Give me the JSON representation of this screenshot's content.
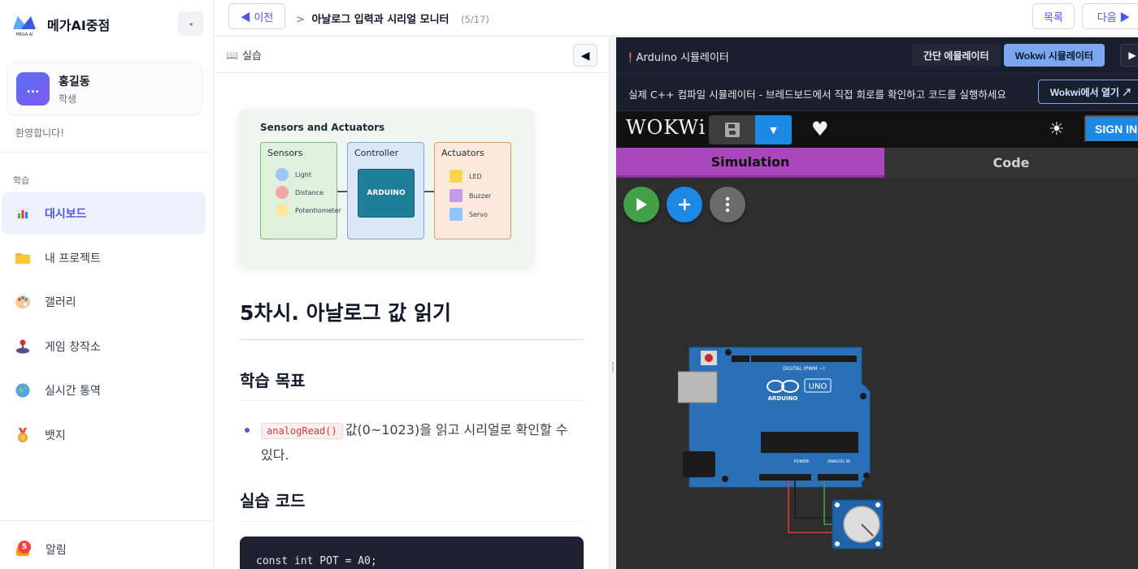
{
  "app": {
    "brand_logo_text": "MEGA AI",
    "brand_name": "메가AI중점",
    "collapse_glyph": "◂"
  },
  "user": {
    "avatar_text": "...",
    "name": "홍길동",
    "role": "학생",
    "welcome": "환영합니다!"
  },
  "sidebar": {
    "section_label": "학습",
    "items": [
      {
        "label": "대시보드",
        "icon": "chart-icon",
        "active": true
      },
      {
        "label": "내 프로젝트",
        "icon": "folder-icon"
      },
      {
        "label": "갤러리",
        "icon": "palette-icon"
      },
      {
        "label": "게임 창작소",
        "icon": "joystick-icon"
      },
      {
        "label": "실시간 통역",
        "icon": "globe-icon"
      },
      {
        "label": "뱃지",
        "icon": "medal-icon"
      }
    ],
    "notifications": {
      "label": "알림",
      "count": "5"
    }
  },
  "topbar": {
    "prev_label": "◀ 이전",
    "breadcrumb_arrow": ">",
    "breadcrumb_title": "아날로그 입력과 시리얼 모니터",
    "progress": "(5/17)",
    "list_label": "목록",
    "next_label": "다음 ▶"
  },
  "lesson": {
    "header_label": "실습",
    "header_icon": "book-icon",
    "toggle_glyph": "◀",
    "diagram": {
      "title": "Sensors and Actuators",
      "sensors_title": "Sensors",
      "sensors": [
        {
          "label": "Light",
          "color": "#9ec5f5"
        },
        {
          "label": "Distance",
          "color": "#f2a7a7"
        },
        {
          "label": "Potentiometer",
          "color": "#fbe79a"
        }
      ],
      "controller_title": "Controller",
      "controller_chip": "ARDUINO",
      "actuators_title": "Actuators",
      "actuators": [
        {
          "label": "LED",
          "color": "#fcd34d"
        },
        {
          "label": "Buzzer",
          "color": "#c49bea"
        },
        {
          "label": "Servo",
          "color": "#93c5fd"
        }
      ]
    },
    "title": "5차시. 아날로그 값 읽기",
    "goal_heading": "학습 목표",
    "goal_code": "analogRead()",
    "goal_text": "값(0~1023)을 읽고 시리얼로 확인할 수 있다.",
    "code_heading": "실습 코드",
    "code_first_line": "const int POT = A0;"
  },
  "simulator": {
    "title": "Arduino 시뮬레이터",
    "title_icon": "pin-icon",
    "mode_simple": "간단 에뮬레이터",
    "mode_wokwi": "Wokwi 시뮬레이터",
    "play_glyph": "▶",
    "subtitle": "실제 C++ 컴파일 시뮬레이터 - 브레드보드에서 직접 회로를 확인하고 코드를 실행하세요",
    "open_label": "Wokwi에서 열기 ↗",
    "wokwi_logo": "WOKWi",
    "signin_label": "SIGN IN",
    "tab_simulation": "Simulation",
    "tab_code": "Code",
    "board_label": "UNO",
    "board_brand": "ARDUINO",
    "digital_label": "DIGITAL (PWM ~)",
    "power_label": "POWER",
    "analog_label": "ANALOG IN"
  },
  "colors": {
    "accent": "#4f56e6",
    "wokwi_blue": "#1e88e5",
    "sim_tab": "#ab47bc",
    "board": "#2a70b8"
  }
}
